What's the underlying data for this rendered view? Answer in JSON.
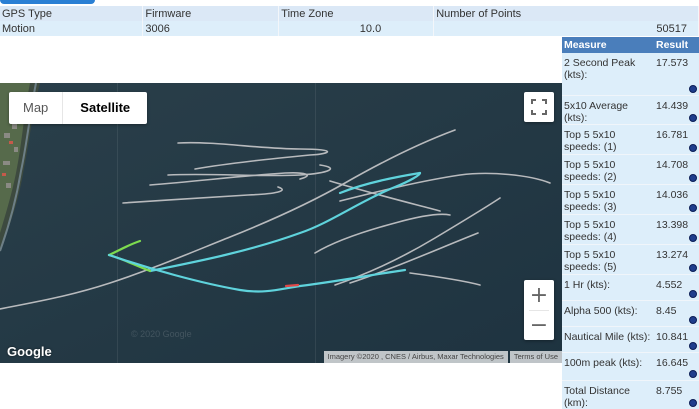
{
  "info": {
    "headers": [
      "GPS Type",
      "Firmware",
      "Time Zone",
      "Number of Points"
    ],
    "values": [
      "Motion",
      "3006",
      "10.0",
      "50517"
    ]
  },
  "map": {
    "tabs": [
      "Map",
      "Satellite"
    ],
    "active_tab": "Satellite",
    "zoom_in": "+",
    "zoom_out": "−",
    "google_logo": "Google",
    "watermark": "© 2020 Google",
    "imagery": "Imagery ©2020 , CNES / Airbus, Maxar Technologies",
    "terms": "Terms of Use",
    "track_colors": {
      "gray": "#b8babd",
      "cyan": "#5fd3dc",
      "green": "#7ddb4f",
      "red": "#e04848"
    }
  },
  "results": {
    "headers": [
      "Measure",
      "Result"
    ],
    "rows": [
      {
        "measure": "2 Second Peak (kts):",
        "result": "17.573"
      },
      {
        "measure": "5x10 Average (kts):",
        "result": "14.439"
      },
      {
        "measure": "Top 5 5x10 speeds: (1)",
        "result": "16.781"
      },
      {
        "measure": "Top 5 5x10 speeds: (2)",
        "result": "14.708"
      },
      {
        "measure": "Top 5 5x10 speeds: (3)",
        "result": "14.036"
      },
      {
        "measure": "Top 5 5x10 speeds: (4)",
        "result": "13.398"
      },
      {
        "measure": "Top 5 5x10 speeds: (5)",
        "result": "13.274"
      },
      {
        "measure": "1 Hr (kts):",
        "result": "4.552"
      },
      {
        "measure": "Alpha 500 (kts):",
        "result": "8.45"
      },
      {
        "measure": "Nautical Mile (kts):",
        "result": "10.841"
      },
      {
        "measure": "100m peak (kts):",
        "result": "16.645"
      },
      {
        "measure": "Total Distance (km):",
        "result": "8.755"
      }
    ]
  }
}
